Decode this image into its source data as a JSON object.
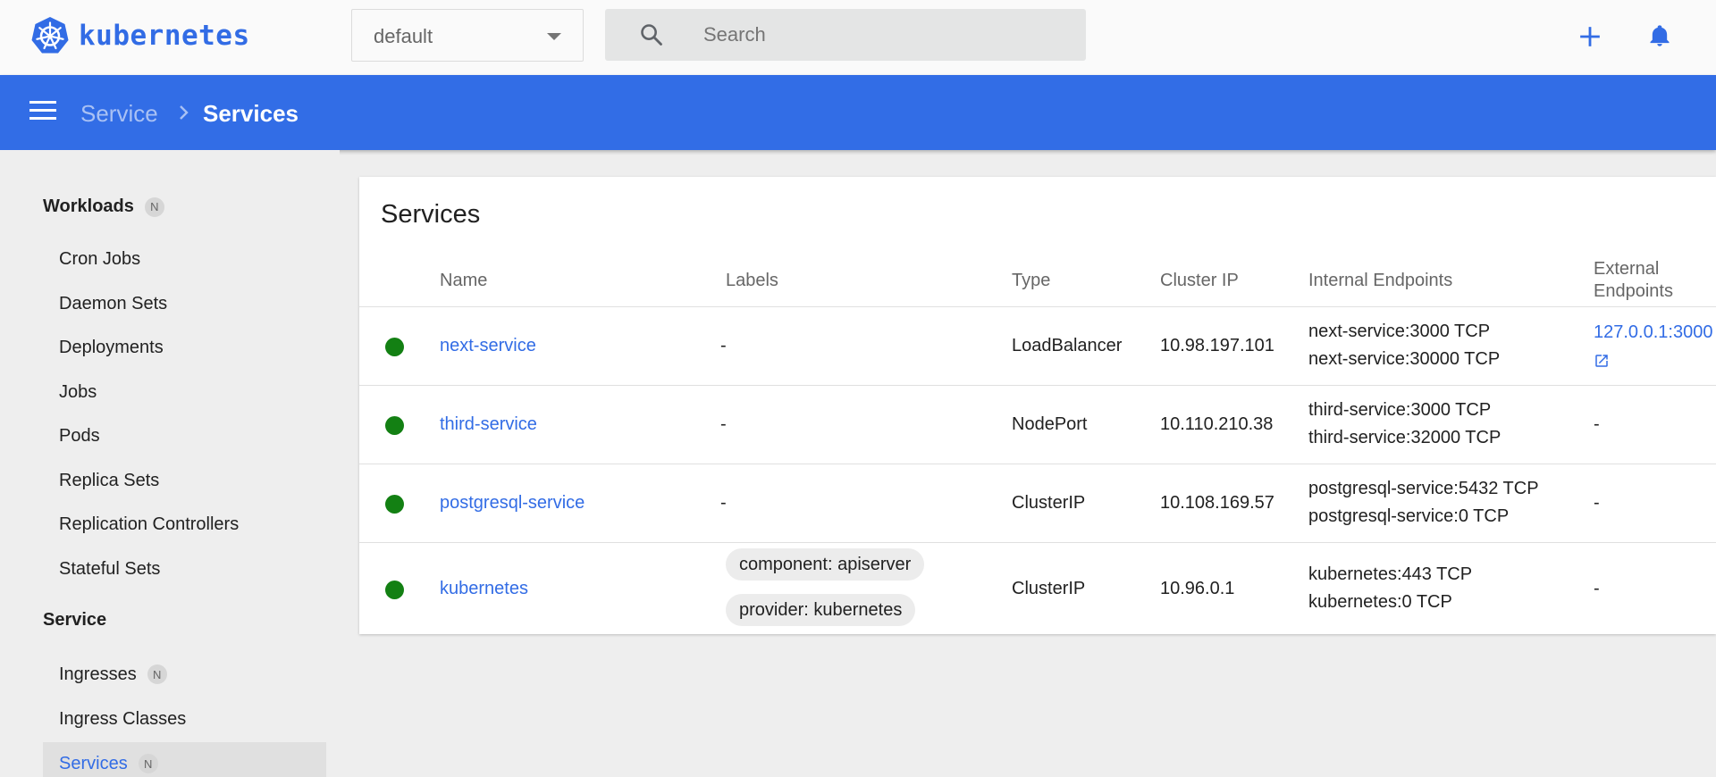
{
  "app": {
    "name": "kubernetes"
  },
  "header": {
    "namespace": "default",
    "search_placeholder": "Search"
  },
  "breadcrumb": {
    "parent": "Service",
    "current": "Services"
  },
  "sidebar": {
    "workloads": {
      "label": "Workloads",
      "badge": "N"
    },
    "workload_items": [
      {
        "label": "Cron Jobs"
      },
      {
        "label": "Daemon Sets"
      },
      {
        "label": "Deployments"
      },
      {
        "label": "Jobs"
      },
      {
        "label": "Pods"
      },
      {
        "label": "Replica Sets"
      },
      {
        "label": "Replication Controllers"
      },
      {
        "label": "Stateful Sets"
      }
    ],
    "service": {
      "label": "Service"
    },
    "service_items": [
      {
        "label": "Ingresses",
        "badge": "N"
      },
      {
        "label": "Ingress Classes"
      },
      {
        "label": "Services",
        "badge": "N",
        "active": true
      }
    ]
  },
  "table": {
    "title": "Services",
    "columns": {
      "name": "Name",
      "labels": "Labels",
      "type": "Type",
      "cluster_ip": "Cluster IP",
      "internal_endpoints": "Internal Endpoints",
      "external_endpoints_1": "External",
      "external_endpoints_2": "Endpoints"
    },
    "rows": [
      {
        "name": "next-service",
        "labels": "-",
        "type": "LoadBalancer",
        "cluster_ip": "10.98.197.101",
        "internal_1": "next-service:3000 TCP",
        "internal_2": "next-service:30000 TCP",
        "external": "127.0.0.1:3000",
        "status_color": "#138013"
      },
      {
        "name": "third-service",
        "labels": "-",
        "type": "NodePort",
        "cluster_ip": "10.110.210.38",
        "internal_1": "third-service:3000 TCP",
        "internal_2": "third-service:32000 TCP",
        "external": "-",
        "status_color": "#138013"
      },
      {
        "name": "postgresql-service",
        "labels": "-",
        "type": "ClusterIP",
        "cluster_ip": "10.108.169.57",
        "internal_1": "postgresql-service:5432 TCP",
        "internal_2": "postgresql-service:0 TCP",
        "external": "-",
        "status_color": "#138013"
      },
      {
        "name": "kubernetes",
        "label_chip_1": "component: apiserver",
        "label_chip_2": "provider: kubernetes",
        "type": "ClusterIP",
        "cluster_ip": "10.96.0.1",
        "internal_1": "kubernetes:443 TCP",
        "internal_2": "kubernetes:0 TCP",
        "external": "-",
        "status_color": "#138013"
      }
    ]
  },
  "colors": {
    "brand": "#326ce5",
    "header_bar": "#326de6",
    "status_ok": "#138013"
  },
  "icons": [
    "kubernetes-logo",
    "search-icon",
    "plus-icon",
    "bell-icon",
    "menu-icon",
    "chevron-right-icon",
    "open-in-new-icon"
  ]
}
